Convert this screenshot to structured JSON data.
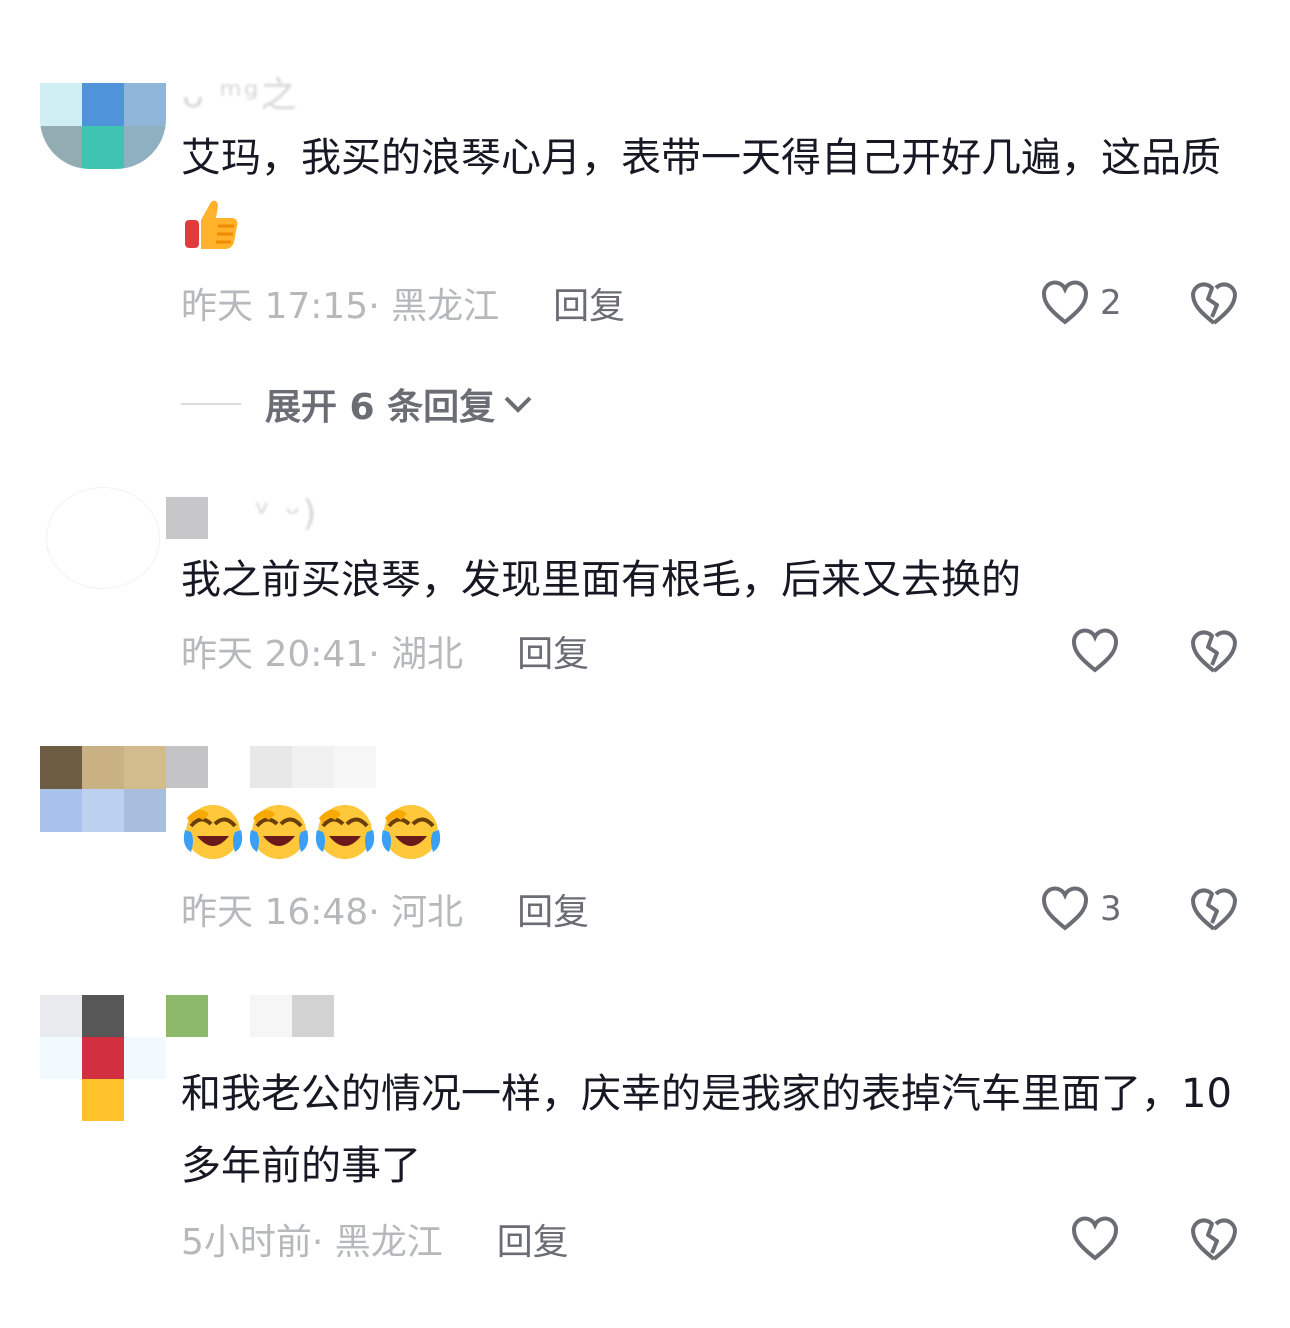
{
  "comments": [
    {
      "text": "艾玛，我买的浪琴心月，表带一天得自己开好几遍，这品质",
      "emoji": "thumbs-up",
      "time": "昨天 17:15",
      "location": "· 黑龙江",
      "reply_label": "回复",
      "likes": "2"
    },
    {
      "text": "我之前买浪琴，发现里面有根毛，后来又去换的",
      "time": "昨天 20:41",
      "location": "· 湖北",
      "reply_label": "回复",
      "likes": ""
    },
    {
      "emoji": "laughing-crying x4",
      "time": "昨天 16:48",
      "location": "· 河北",
      "reply_label": "回复",
      "likes": "3"
    },
    {
      "text": "和我老公的情况一样，庆幸的是我家的表掉汽车里面了，10多年前的事了",
      "time": "5小时前",
      "location": "· 黑龙江",
      "reply_label": "回复",
      "likes": ""
    }
  ],
  "expand_replies": "展开 6 条回复",
  "colors": {
    "primary_text": "#161823",
    "secondary_text": "#b7b8bc",
    "action_text": "#6b6d74"
  }
}
